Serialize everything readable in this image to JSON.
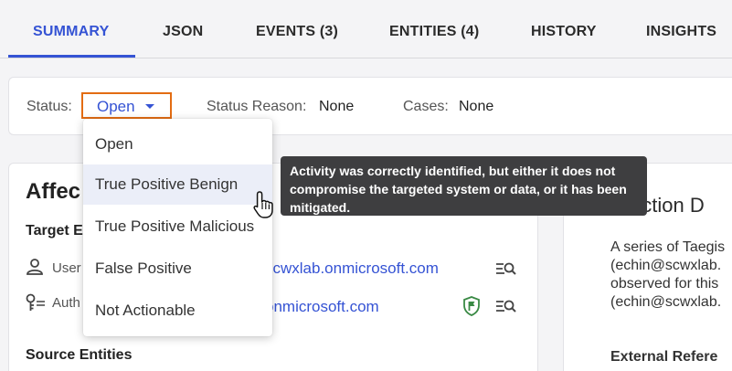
{
  "tabs": [
    {
      "label": "SUMMARY",
      "active": true
    },
    {
      "label": "JSON"
    },
    {
      "label": "EVENTS (3)"
    },
    {
      "label": "ENTITIES (4)"
    },
    {
      "label": "HISTORY"
    },
    {
      "label": "INSIGHTS"
    }
  ],
  "status_bar": {
    "status_label": "Status:",
    "status_value": "Open",
    "reason_label": "Status Reason:",
    "reason_value": "None",
    "cases_label": "Cases:",
    "cases_value": "None"
  },
  "status_menu": {
    "options": [
      "Open",
      "True Positive Benign",
      "True Positive Malicious",
      "False Positive",
      "Not Actionable"
    ],
    "hovered": "True Positive Benign"
  },
  "tooltip": {
    "lines": [
      "Activity was correctly identified, but either it does not",
      "compromise the targeted system or data, or it has been",
      "mitigated."
    ]
  },
  "affected": {
    "heading": "Affec",
    "target_heading": "Target E",
    "rows": [
      {
        "label": "User",
        "link": "scwxlab.onmicrosoft.com",
        "icon": "user-icon"
      },
      {
        "label": "Auth",
        "link": "onmicrosoft.com",
        "icon": "key-icon"
      }
    ],
    "source_heading": "Source Entities"
  },
  "detection": {
    "heading": "ection D",
    "description_lines": [
      "A series of Taegis",
      "(echin@scwxlab.",
      "observed for this",
      "(echin@scwxlab."
    ],
    "external_heading": "External Refere"
  },
  "colors": {
    "accent": "#3553d4",
    "focus_border": "#e36c12",
    "shield": "#3a8a45",
    "tooltip_bg": "#3e3e40"
  }
}
